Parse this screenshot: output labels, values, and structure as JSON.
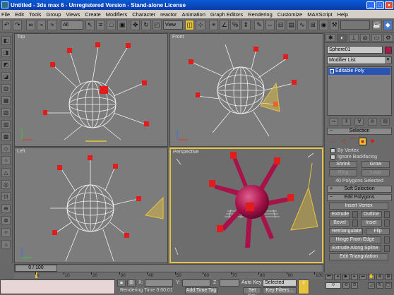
{
  "window": {
    "title": "Untitled - 3ds max 6 - Unregistered Version - Stand-alone License",
    "minimize": "_",
    "maximize": "□",
    "close": "×"
  },
  "menu": [
    "File",
    "Edit",
    "Tools",
    "Group",
    "Views",
    "Create",
    "Modifiers",
    "Character",
    "reactor",
    "Animation",
    "Graph Editors",
    "Rendering",
    "Customize",
    "MAXScript",
    "Help"
  ],
  "toolbar": {
    "filter_select": "All",
    "coord_select": "View"
  },
  "viewports": {
    "top": "Top",
    "front": "Front",
    "left": "Left",
    "perspective": "Perspective"
  },
  "panel": {
    "object_name": "Sphere01",
    "object_color": "#b2134f",
    "modifier_list": "Modifier List",
    "stack_item": "Editable Poly",
    "selection_title": "Selection",
    "by_vertex": "By Vertex",
    "ignore_backfacing": "Ignore Backfacing",
    "shrink": "Shrink",
    "grow": "Grow",
    "ring": "Ring",
    "loop": "Loop",
    "selected_count": "40 Polygons Selected",
    "soft_selection": "Soft Selection",
    "edit_polygons": "Edit Polygons",
    "insert_vertex": "Insert Vertex",
    "extrude": "Extrude",
    "outline": "Outline",
    "bevel": "Bevel",
    "inset": "Inset",
    "retriangulate": "Retriangulate",
    "flip": "Flip",
    "hinge_from_edge": "Hinge From Edge",
    "extrude_along_spline": "Extrude Along Spline",
    "edit_triangulation": "Edit Triangulation"
  },
  "timeline": {
    "slider": "0 / 100",
    "ticks": [
      "0",
      "10",
      "20",
      "30",
      "40",
      "50",
      "60",
      "70",
      "80",
      "90",
      "100"
    ]
  },
  "status": {
    "x_label": "X:",
    "y_label": "Y:",
    "z_label": "Z:",
    "rendering_time": "Rendering Time  0:00:01",
    "add_time_tag": "Add Time Tag",
    "auto_key": "Auto Key",
    "auto_key_mode": "Selected",
    "set_key": "Set Key",
    "key_filters": "Key Filters...",
    "frame": "0"
  },
  "colors": {
    "accent": "#e8c33d",
    "object": "#b2134f",
    "selected_face": "#e21b1b",
    "titlebar": "#0a5ad6"
  }
}
